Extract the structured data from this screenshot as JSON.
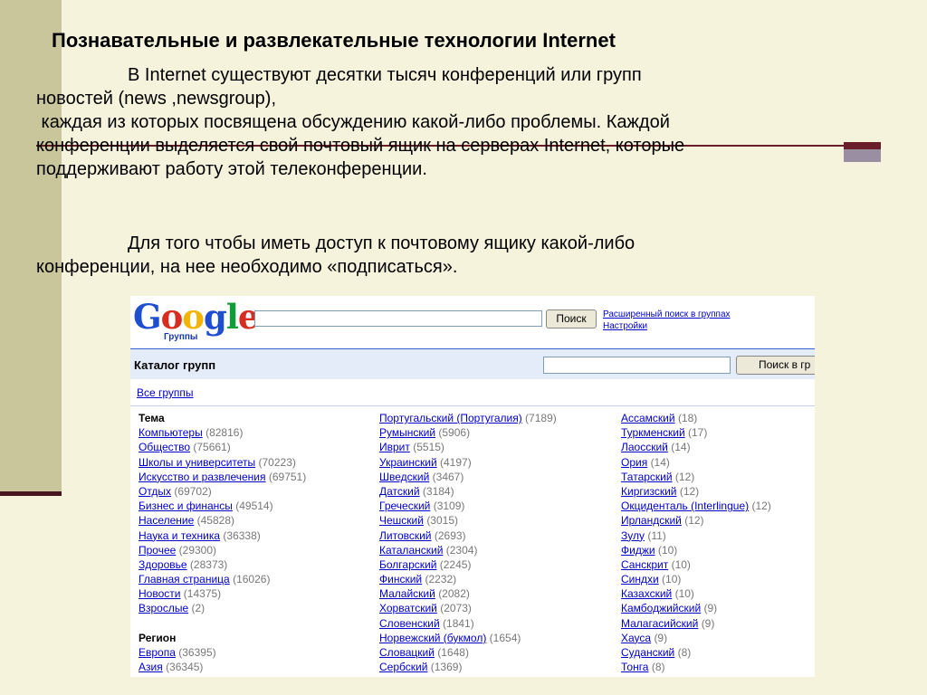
{
  "slide": {
    "title": "Познавательные и развлекательные технологии Internet",
    "paragraph1": [
      "В Internet существуют десятки тысяч конференций или групп",
      "новостей (news ,newsgroup),",
      " каждая из которых посвящена обсуждению какой-либо проблемы. Каждой",
      "конференции выделяется свой почтовый ящик на серверах Internet, которые",
      "поддерживают работу этой телеконференции."
    ],
    "paragraph2": [
      "Для того чтобы иметь доступ к почтовому ящику какой-либо",
      "конференции, на нее необходимо «подписаться»."
    ]
  },
  "screenshot": {
    "logo_text": "Google",
    "logo_sub": "Группы",
    "search_button": "Поиск",
    "advanced_link": "Расширенный поиск в группах",
    "settings_link": "Настройки",
    "catalog_title": "Каталог групп",
    "catalog_search_button": "Поиск в гр",
    "all_groups_link": "Все группы",
    "columns": [
      [
        {
          "type": "header",
          "label": "Тема"
        },
        {
          "label": "Компьютеры",
          "count": "(82816)"
        },
        {
          "label": "Общество",
          "count": "(75661)"
        },
        {
          "label": "Школы и университеты",
          "count": "(70223)"
        },
        {
          "label": "Искусство и развлечения",
          "count": "(69751)"
        },
        {
          "label": "Отдых",
          "count": "(69702)"
        },
        {
          "label": "Бизнес и финансы",
          "count": "(49514)"
        },
        {
          "label": "Население",
          "count": "(45828)"
        },
        {
          "label": "Наука и техника",
          "count": "(36338)"
        },
        {
          "label": "Прочее",
          "count": "(29300)"
        },
        {
          "label": "Здоровье",
          "count": "(28373)"
        },
        {
          "label": "Главная страница",
          "count": "(16026)"
        },
        {
          "label": "Новости",
          "count": "(14375)"
        },
        {
          "label": "Взрослые",
          "count": "(2)"
        },
        {
          "type": "blank"
        },
        {
          "type": "header",
          "label": "Регион"
        },
        {
          "label": "Европа",
          "count": "(36395)"
        },
        {
          "label": "Азия",
          "count": "(36345)"
        }
      ],
      [
        {
          "label": "Португальский (Португалия)",
          "count": "(7189)"
        },
        {
          "label": "Румынский",
          "count": "(5906)"
        },
        {
          "label": "Иврит",
          "count": "(5515)"
        },
        {
          "label": "Украинский",
          "count": "(4197)"
        },
        {
          "label": "Шведский",
          "count": "(3467)"
        },
        {
          "label": "Датский",
          "count": "(3184)"
        },
        {
          "label": "Греческий",
          "count": "(3109)"
        },
        {
          "label": "Чешский",
          "count": "(3015)"
        },
        {
          "label": "Литовский",
          "count": "(2693)"
        },
        {
          "label": "Каталанский",
          "count": "(2304)"
        },
        {
          "label": "Болгарский",
          "count": "(2245)"
        },
        {
          "label": "Финский",
          "count": "(2232)"
        },
        {
          "label": "Малайский",
          "count": "(2082)"
        },
        {
          "label": "Хорватский",
          "count": "(2073)"
        },
        {
          "label": "Словенский",
          "count": "(1841)"
        },
        {
          "label": "Норвежский (букмол)",
          "count": "(1654)"
        },
        {
          "label": "Словацкий",
          "count": "(1648)"
        },
        {
          "label": "Сербский",
          "count": "(1369)"
        }
      ],
      [
        {
          "label": "Ассамский",
          "count": "(18)"
        },
        {
          "label": "Туркменский",
          "count": "(17)"
        },
        {
          "label": "Лаосский",
          "count": "(14)"
        },
        {
          "label": "Ория",
          "count": "(14)"
        },
        {
          "label": "Татарский",
          "count": "(12)"
        },
        {
          "label": "Киргизский",
          "count": "(12)"
        },
        {
          "label": "Окциденталь (Interlingue)",
          "count": "(12)"
        },
        {
          "label": "Ирландский",
          "count": "(12)"
        },
        {
          "label": "Зулу",
          "count": "(11)"
        },
        {
          "label": "Фиджи",
          "count": "(10)"
        },
        {
          "label": "Санскрит",
          "count": "(10)"
        },
        {
          "label": "Синдхи",
          "count": "(10)"
        },
        {
          "label": "Казахский",
          "count": "(10)"
        },
        {
          "label": "Камбоджийский",
          "count": "(9)"
        },
        {
          "label": "Малагасийский",
          "count": "(9)"
        },
        {
          "label": "Хауса",
          "count": "(9)"
        },
        {
          "label": "Суданский",
          "count": "(8)"
        },
        {
          "label": "Тонга",
          "count": "(8)"
        }
      ]
    ]
  },
  "colors": {
    "background": "#f5f3dc",
    "strip": "#c8c69a",
    "accent": "#6a1e2a",
    "link": "#0000cc"
  }
}
